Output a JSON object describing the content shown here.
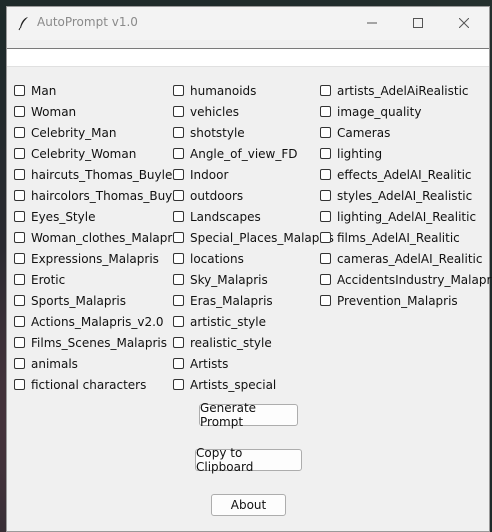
{
  "window": {
    "title": "AutoPrompt v1.0"
  },
  "prompt_entry": {
    "value": ""
  },
  "checkboxes": {
    "col1": [
      "Man",
      "Woman",
      "Celebrity_Man",
      "Celebrity_Woman",
      "haircuts_Thomas_Buyle",
      "haircolors_Thomas_Buyle",
      "Eyes_Style",
      "Woman_clothes_Malapris",
      "Expressions_Malapris",
      "Erotic",
      "Sports_Malapris",
      "Actions_Malapris_v2.0",
      "Films_Scenes_Malapris",
      "animals",
      "fictional characters"
    ],
    "col2": [
      "humanoids",
      "vehicles",
      "shotstyle",
      "Angle_of_view_FD",
      "Indoor",
      "outdoors",
      "Landscapes",
      "Special_Places_Malapris",
      "locations",
      "Sky_Malapris",
      "Eras_Malapris",
      "artistic_style",
      "realistic_style",
      "Artists",
      "Artists_special"
    ],
    "col3": [
      "artists_AdelAiRealistic",
      "image_quality",
      "Cameras",
      "lighting",
      "effects_AdelAI_Realitic",
      "styles_AdelAI_Realistic",
      "lighting_AdelAI_Realitic",
      "films_AdelAI_Realitic",
      "cameras_AdelAI_Realitic",
      "AccidentsIndustry_Malapris",
      "Prevention_Malapris"
    ]
  },
  "buttons": {
    "generate": "Generate Prompt",
    "copy": "Copy to Clipboard",
    "about": "About"
  },
  "icons": {
    "app": "feather-icon",
    "minimize": "minimize-icon",
    "maximize": "maximize-icon",
    "close": "close-icon"
  }
}
